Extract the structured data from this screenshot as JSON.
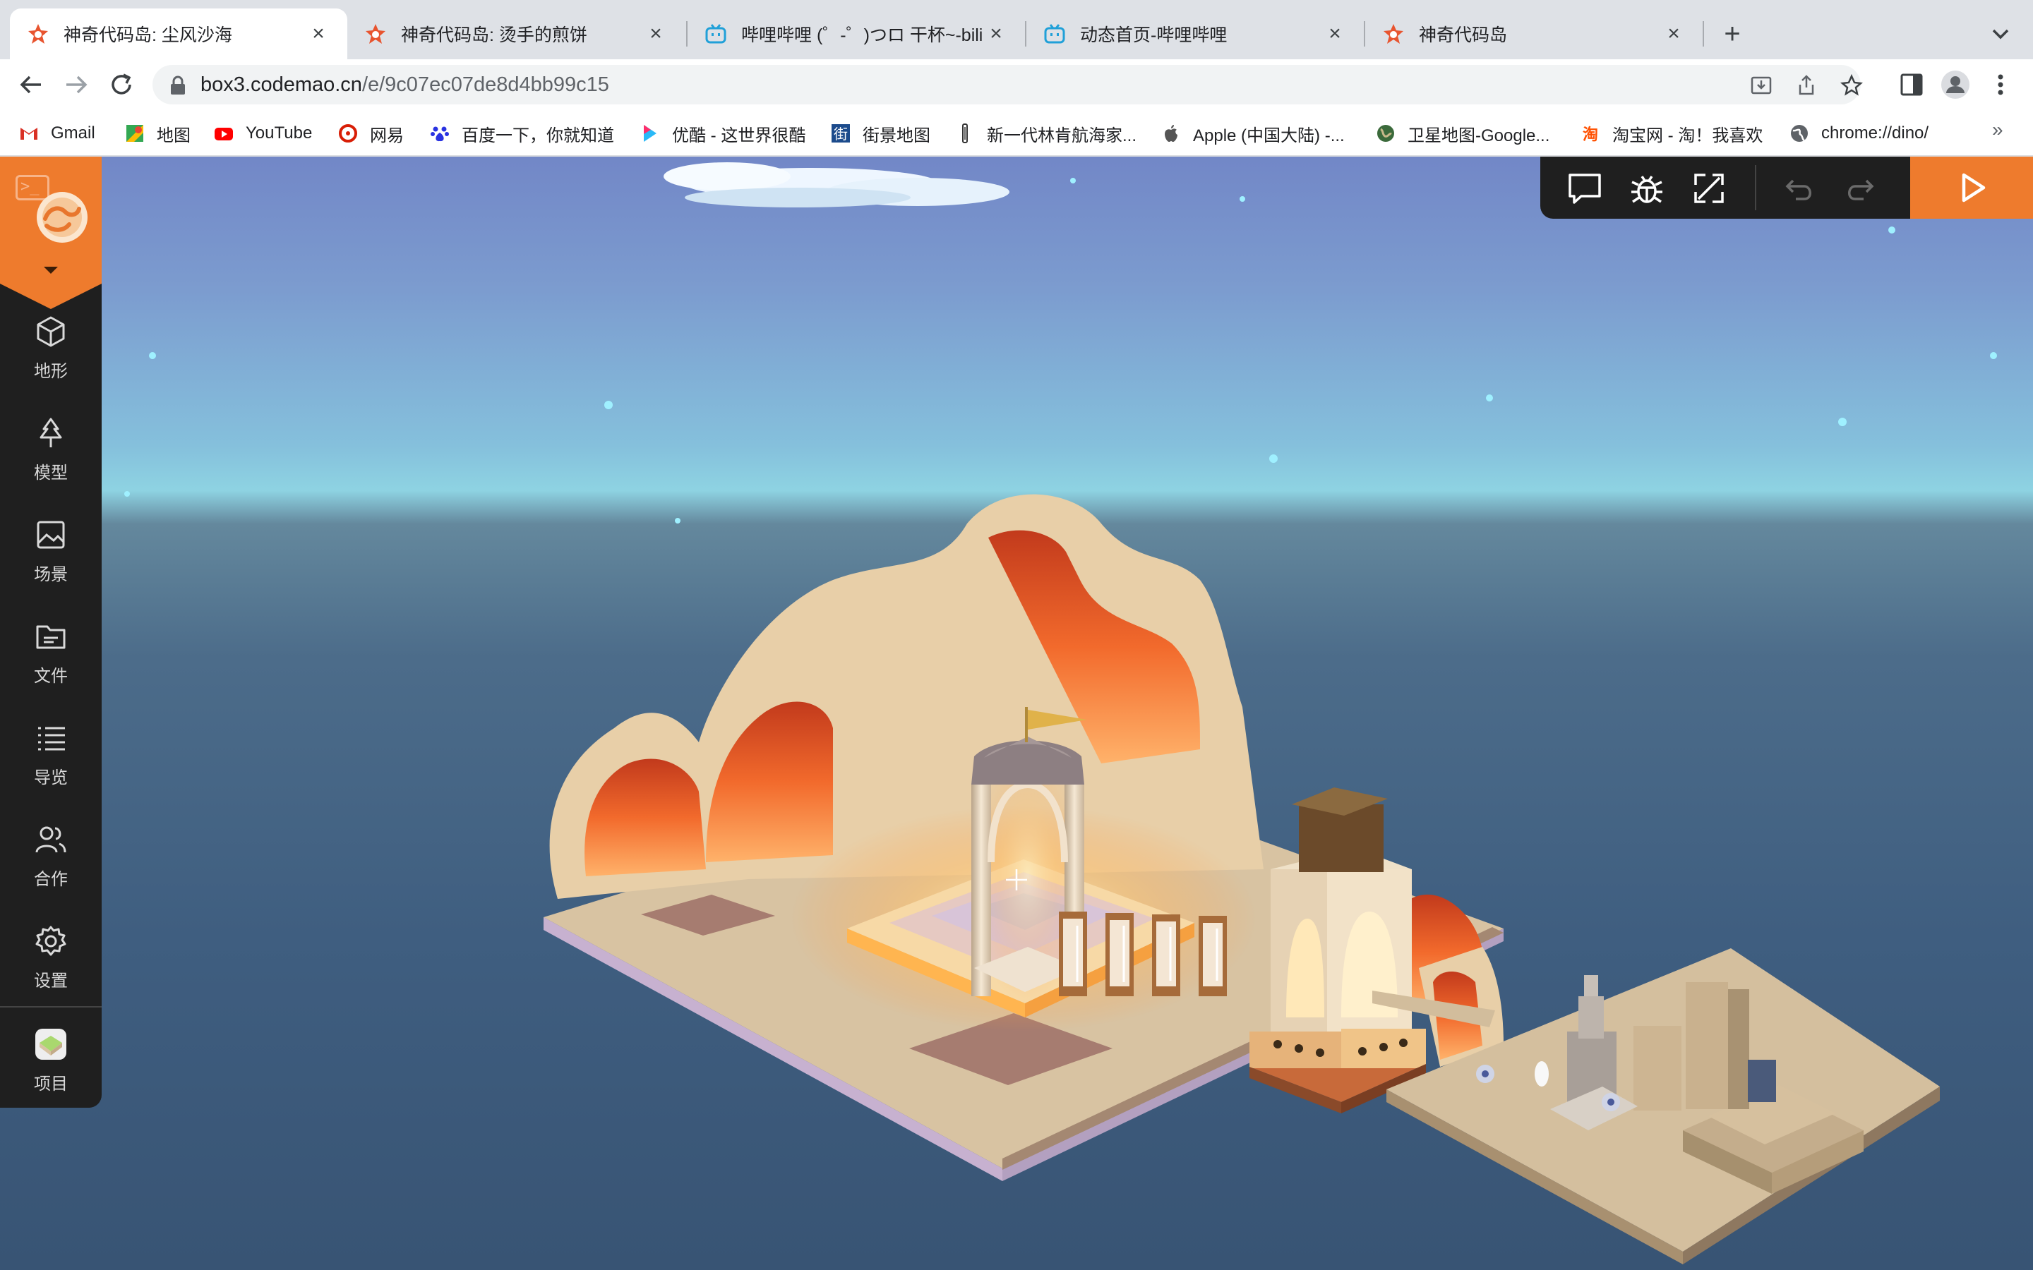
{
  "browser": {
    "tabs": [
      {
        "title": "神奇代码岛: 尘风沙海",
        "favicon": "codemao-icon",
        "active": true
      },
      {
        "title": "神奇代码岛: 烫手的煎饼",
        "favicon": "codemao-icon",
        "active": false
      },
      {
        "title": "哔哩哔哩 (゜-゜)つロ 干杯~-bilil",
        "favicon": "bilibili-icon",
        "active": false
      },
      {
        "title": "动态首页-哔哩哔哩",
        "favicon": "bilibili-icon",
        "active": false
      },
      {
        "title": "神奇代码岛",
        "favicon": "codemao-icon",
        "active": false
      }
    ],
    "url_host": "box3.codemao.cn",
    "url_path": "/e/9c07ec07de8d4bb99c15",
    "bookmarks": [
      {
        "label": "Gmail",
        "icon": "gmail-icon"
      },
      {
        "label": "地图",
        "icon": "maps-icon"
      },
      {
        "label": "YouTube",
        "icon": "youtube-icon"
      },
      {
        "label": "网易",
        "icon": "netease-icon"
      },
      {
        "label": "百度一下，你就知道",
        "icon": "baidu-icon"
      },
      {
        "label": "优酷 - 这世界很酷",
        "icon": "youku-icon"
      },
      {
        "label": "街景地图",
        "icon": "streetview-icon"
      },
      {
        "label": "新一代林肯航海家...",
        "icon": "lincoln-icon"
      },
      {
        "label": "Apple (中国大陆) -...",
        "icon": "apple-icon"
      },
      {
        "label": "卫星地图-Google...",
        "icon": "globe-icon"
      },
      {
        "label": "淘宝网 - 淘！我喜欢",
        "icon": "taobao-icon"
      },
      {
        "label": "chrome://dino/",
        "icon": "chrome-globe-icon"
      }
    ],
    "bookmarks_more": "»"
  },
  "sidebar": {
    "terminal_glyph": ">_",
    "items": [
      {
        "label": "地形",
        "icon": "cube-icon"
      },
      {
        "label": "模型",
        "icon": "tree-icon"
      },
      {
        "label": "场景",
        "icon": "image-icon"
      },
      {
        "label": "文件",
        "icon": "folder-icon"
      },
      {
        "label": "导览",
        "icon": "list-icon"
      },
      {
        "label": "合作",
        "icon": "users-icon"
      },
      {
        "label": "设置",
        "icon": "gear-icon"
      }
    ],
    "project_label": "项目"
  },
  "toolbar": {
    "tools": [
      "chat-icon",
      "bug-icon",
      "fullscreen-icon",
      "undo-icon",
      "redo-icon"
    ],
    "play": "play-icon"
  },
  "colors": {
    "accent": "#ee7b2d",
    "sidebar_bg": "#1f1f1f",
    "sand": "#d8c3a2",
    "lava": "#e0582a"
  }
}
